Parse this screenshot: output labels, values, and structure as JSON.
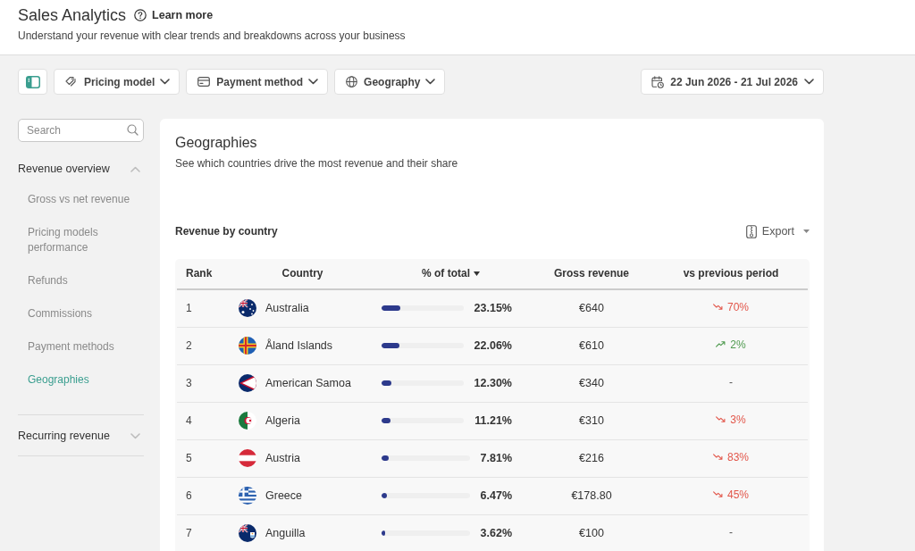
{
  "header": {
    "title": "Sales Analytics",
    "help_link": "Learn more",
    "subtitle": "Understand your revenue with clear trends and breakdowns across your business"
  },
  "toolbar": {
    "filters": [
      {
        "label": "Pricing model",
        "kind": "tag"
      },
      {
        "label": "Payment method",
        "kind": "card"
      },
      {
        "label": "Geography",
        "kind": "globe"
      }
    ],
    "date_range": "22 Jun 2026 - 21 Jul 2026"
  },
  "sidebar": {
    "search": {
      "placeholder": "Search"
    },
    "sections": [
      {
        "label": "Revenue overview",
        "expanded": true,
        "children": [
          {
            "label": "Gross vs net revenue",
            "selected": false
          },
          {
            "label": "Pricing models performance",
            "selected": false
          },
          {
            "label": "Refunds",
            "selected": false
          },
          {
            "label": "Commissions",
            "selected": false
          },
          {
            "label": "Payment methods",
            "selected": false
          },
          {
            "label": "Geographies",
            "selected": true
          }
        ]
      },
      {
        "label": "Recurring revenue",
        "expanded": false
      }
    ]
  },
  "main": {
    "title": "Geographies",
    "subtitle": "See which countries drive the most revenue and their share",
    "table_title": "Revenue by country",
    "export": "Export",
    "table": {
      "columns": [
        {
          "label": "Rank",
          "sorted": false
        },
        {
          "label": "Country",
          "sorted": false
        },
        {
          "label": "% of total",
          "sorted": true
        },
        {
          "label": "Gross revenue",
          "sorted": false
        },
        {
          "label": "vs previous period",
          "sorted": false
        }
      ],
      "rows": [
        {
          "rank": "1",
          "country": "Australia",
          "level": 0.2315,
          "share": "23.15%",
          "revenue": "€640",
          "change": {
            "kind": "down",
            "value": "70%"
          }
        },
        {
          "rank": "2",
          "country": "Åland Islands",
          "level": 0.2206,
          "share": "22.06%",
          "revenue": "€610",
          "change": {
            "kind": "up",
            "value": "2%"
          }
        },
        {
          "rank": "3",
          "country": "American Samoa",
          "level": 0.123,
          "share": "12.30%",
          "revenue": "€340",
          "change": {
            "kind": "none",
            "value": "-"
          }
        },
        {
          "rank": "4",
          "country": "Algeria",
          "level": 0.1121,
          "share": "11.21%",
          "revenue": "€310",
          "change": {
            "kind": "down",
            "value": "3%"
          }
        },
        {
          "rank": "5",
          "country": "Austria",
          "level": 0.0781,
          "share": "7.81%",
          "revenue": "€216",
          "change": {
            "kind": "down",
            "value": "83%"
          }
        },
        {
          "rank": "6",
          "country": "Greece",
          "level": 0.0647,
          "share": "6.47%",
          "revenue": "€178.80",
          "change": {
            "kind": "down",
            "value": "45%"
          }
        },
        {
          "rank": "7",
          "country": "Anguilla",
          "level": 0.0362,
          "share": "3.62%",
          "revenue": "€100",
          "change": {
            "kind": "none",
            "value": "-"
          }
        }
      ]
    }
  }
}
